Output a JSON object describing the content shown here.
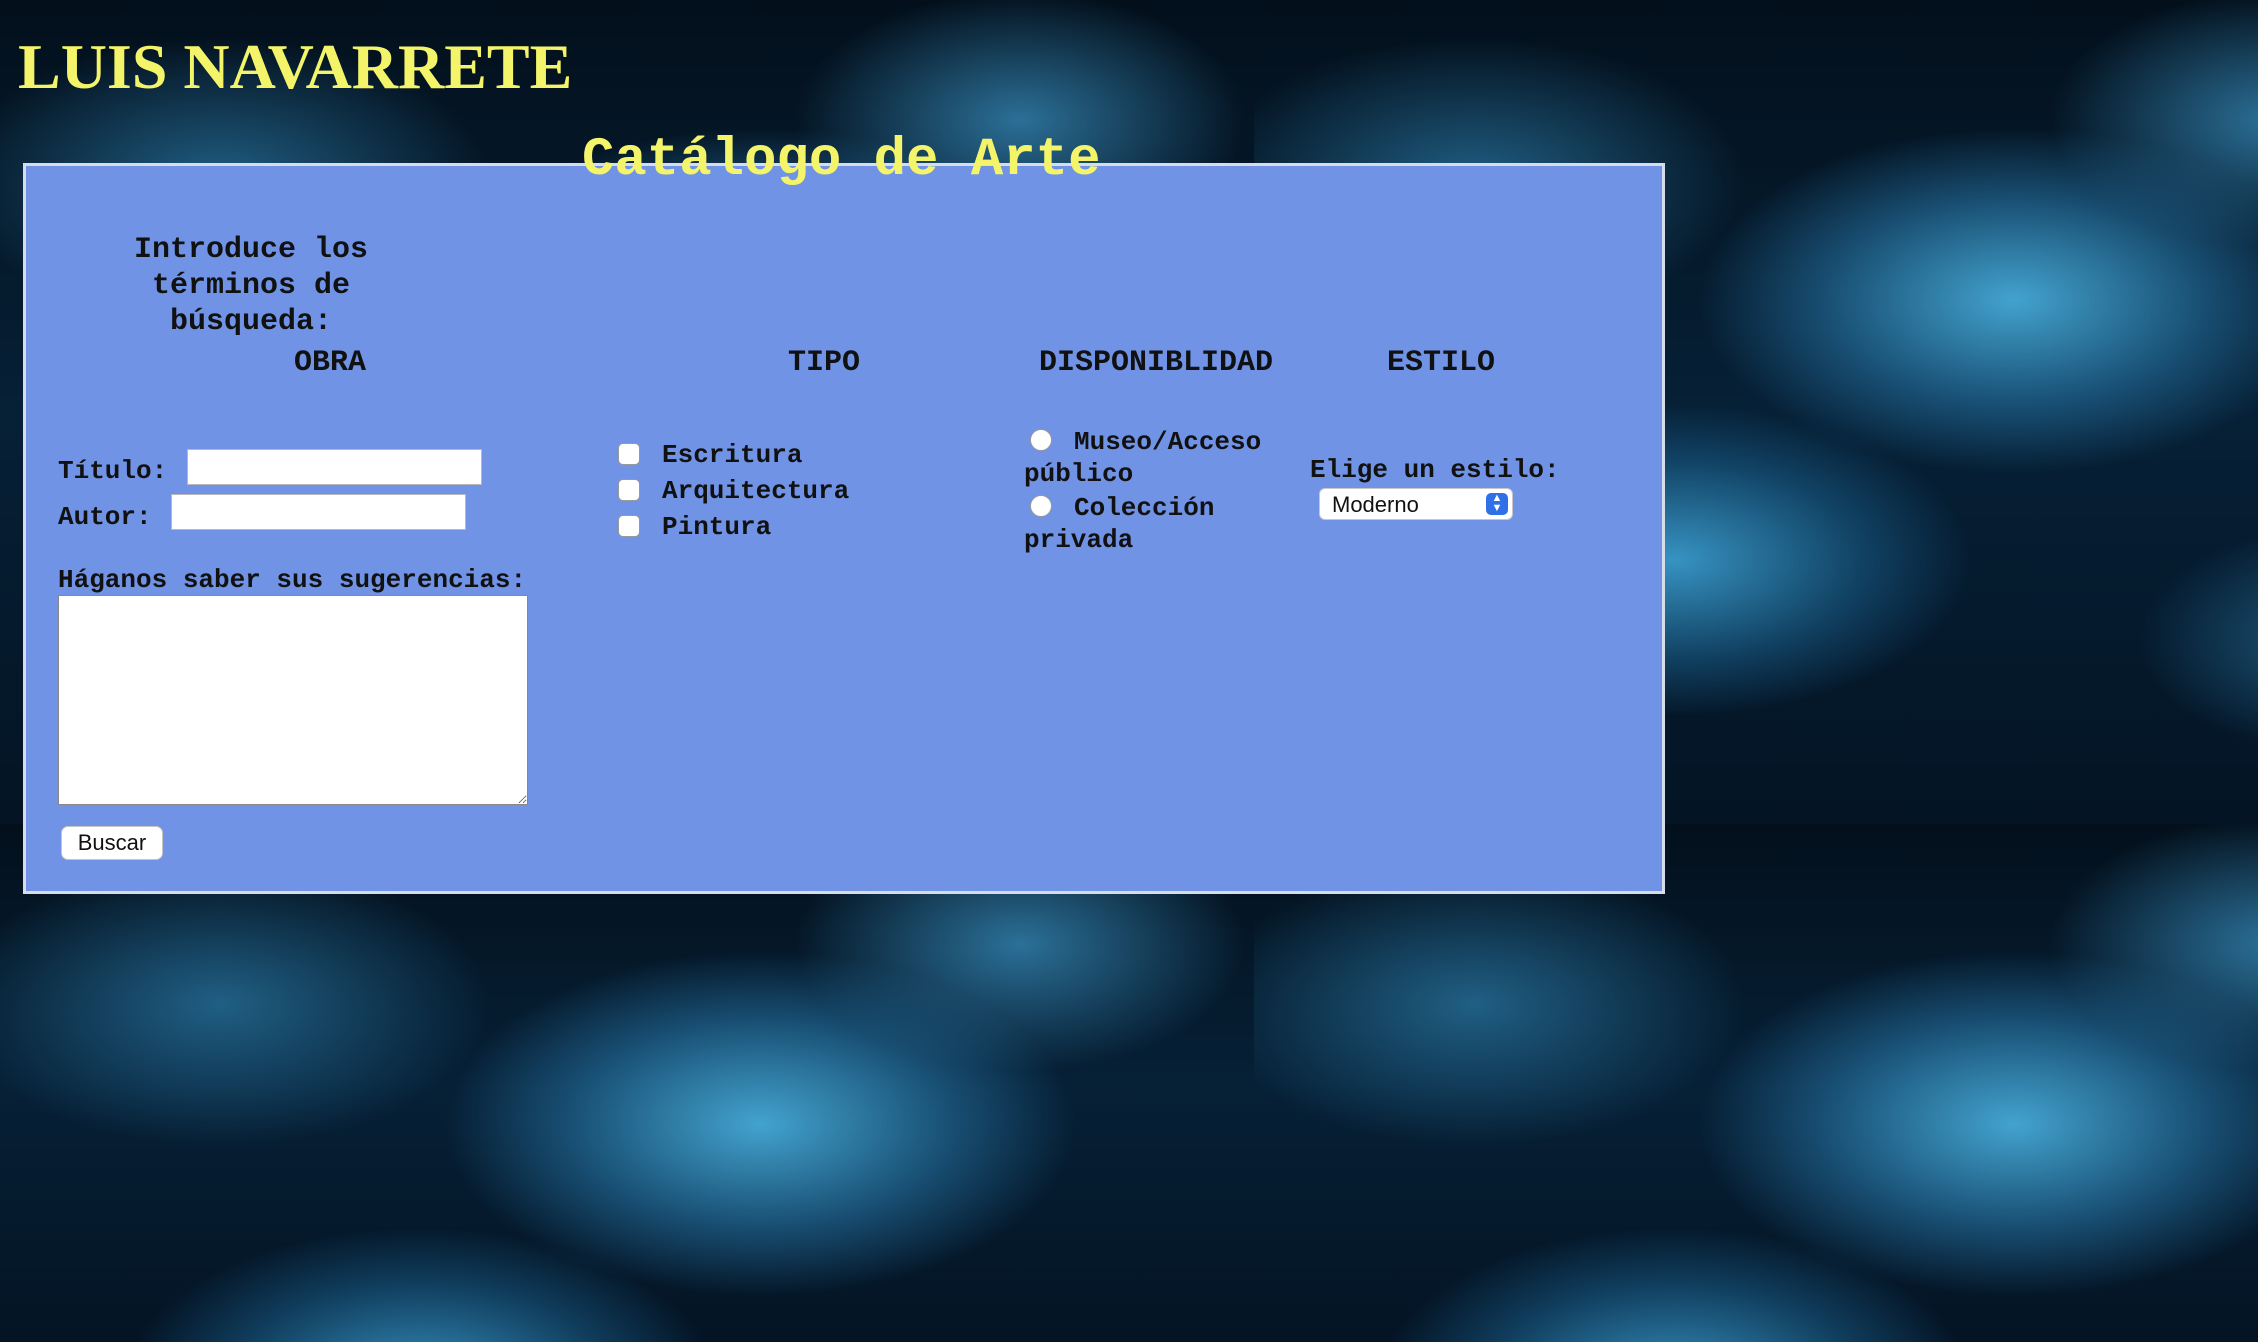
{
  "site": {
    "title": "LUIS NAVARRETE"
  },
  "form": {
    "legend": "Catálogo de Arte",
    "intro": "Introduce los términos de búsqueda:",
    "columns": {
      "obra": "OBRA",
      "tipo": "TIPO",
      "disponibilidad": "DISPONIBLIDAD",
      "estilo": "ESTILO"
    },
    "obra": {
      "titulo_label": "Título:",
      "titulo_value": "",
      "autor_label": "Autor:",
      "autor_value": "",
      "sugerencias_label": "Háganos saber sus sugerencias:",
      "sugerencias_value": ""
    },
    "tipo": {
      "options": [
        {
          "label": "Escritura",
          "checked": false
        },
        {
          "label": "Arquitectura",
          "checked": false
        },
        {
          "label": "Pintura",
          "checked": false
        }
      ]
    },
    "disponibilidad": {
      "options": [
        {
          "label_line1": "Museo/Acceso",
          "label_line2": "público",
          "selected": false
        },
        {
          "label_line1": "Colección",
          "label_line2": "privada",
          "selected": false
        }
      ]
    },
    "estilo": {
      "label": "Elige un estilo:",
      "selected": "Moderno"
    },
    "submit_label": "Buscar"
  },
  "colors": {
    "title_yellow": "#f4f46a",
    "panel_blue": "#7093e6",
    "select_accent": "#2f6fe8"
  }
}
